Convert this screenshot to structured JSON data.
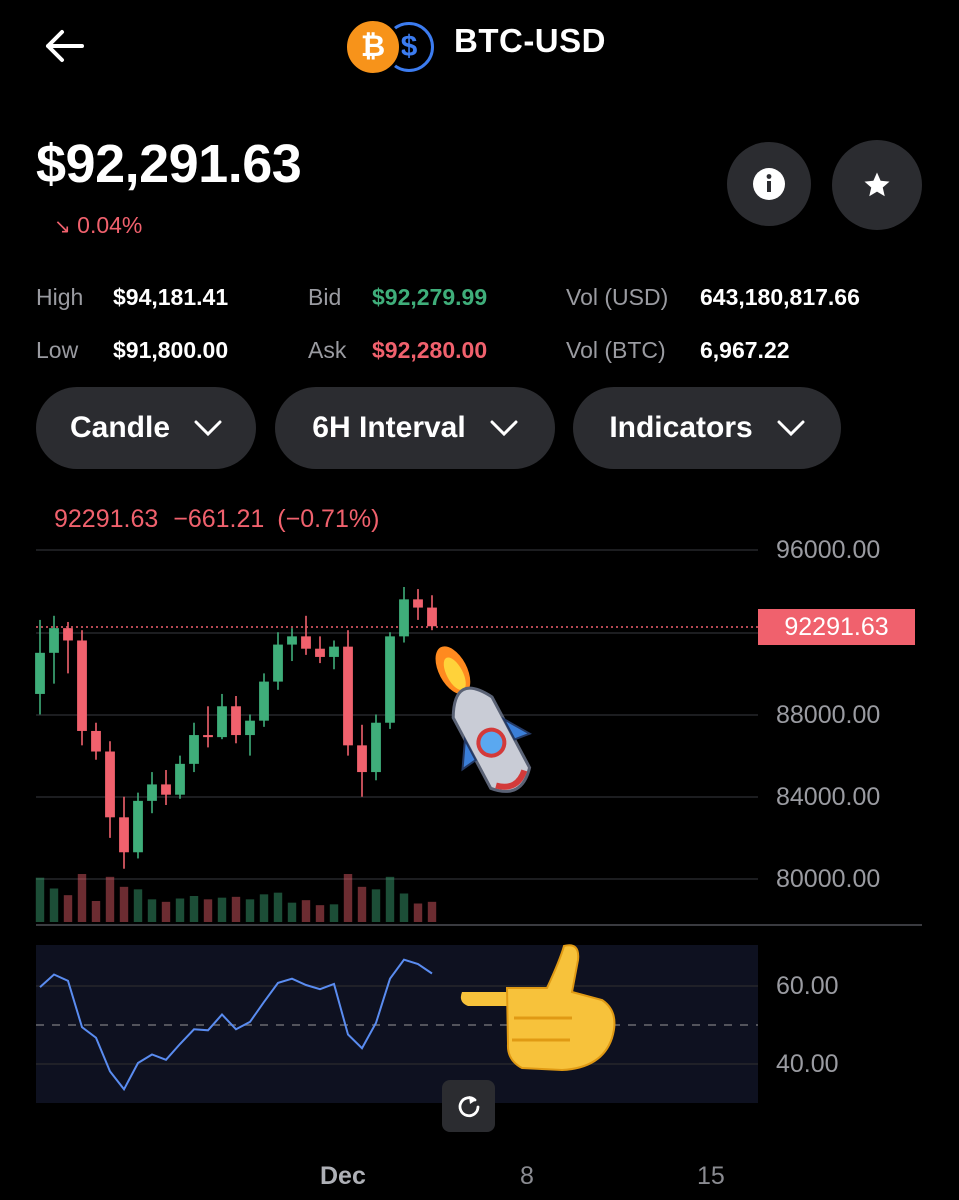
{
  "header": {
    "title": "BTC-USD",
    "btc_symbol": "₿",
    "usd_symbol": "$"
  },
  "price": {
    "current": "$92,291.63",
    "change_pct": "0.04%",
    "change_dir": "down"
  },
  "stats": {
    "high_label": "High",
    "high": "$94,181.41",
    "low_label": "Low",
    "low": "$91,800.00",
    "bid_label": "Bid",
    "bid": "$92,279.99",
    "ask_label": "Ask",
    "ask": "$92,280.00",
    "vol_usd_label": "Vol (USD)",
    "vol_usd": "643,180,817.66",
    "vol_btc_label": "Vol (BTC)",
    "vol_btc": "6,967.22"
  },
  "controls": {
    "chart_type": "Candle",
    "interval": "6H Interval",
    "indicators": "Indicators"
  },
  "chart": {
    "ohlc_close": "92291.63",
    "ohlc_change": "−661.21",
    "ohlc_change_pct": "(−0.71%)",
    "price_tag": "92291.63",
    "y_ticks": [
      "96000.00",
      "88000.00",
      "84000.00",
      "80000.00"
    ],
    "rsi_ticks": [
      "60.00",
      "40.00"
    ],
    "x_ticks": [
      "Dec",
      "8",
      "15"
    ]
  },
  "colors": {
    "up": "#3fae7a",
    "down": "#f0616d",
    "rsi": "#5a8cf0",
    "bg": "#000000",
    "pill": "#2b2c30"
  },
  "icons": [
    "back-arrow-icon",
    "info-icon",
    "star-icon",
    "chevron-down-icon",
    "reset-icon",
    "rocket-emoji",
    "pointing-hand-emoji"
  ],
  "chart_data": {
    "type": "candlestick",
    "interval": "6H",
    "current_price": 92291.63,
    "ylim": [
      78000,
      96000
    ],
    "price_line": 92291.63,
    "candles_approx": [
      {
        "o": 89000,
        "h": 92600,
        "l": 88000,
        "c": 91000
      },
      {
        "o": 91000,
        "h": 92800,
        "l": 89500,
        "c": 92200
      },
      {
        "o": 92200,
        "h": 92500,
        "l": 90000,
        "c": 91600
      },
      {
        "o": 91600,
        "h": 92100,
        "l": 86500,
        "c": 87200
      },
      {
        "o": 87200,
        "h": 87600,
        "l": 85800,
        "c": 86200
      },
      {
        "o": 86200,
        "h": 86700,
        "l": 82000,
        "c": 83000
      },
      {
        "o": 83000,
        "h": 84000,
        "l": 80500,
        "c": 81300
      },
      {
        "o": 81300,
        "h": 84200,
        "l": 81000,
        "c": 83800
      },
      {
        "o": 83800,
        "h": 85200,
        "l": 83200,
        "c": 84600
      },
      {
        "o": 84600,
        "h": 85300,
        "l": 83600,
        "c": 84100
      },
      {
        "o": 84100,
        "h": 86000,
        "l": 83900,
        "c": 85600
      },
      {
        "o": 85600,
        "h": 87600,
        "l": 85200,
        "c": 87000
      },
      {
        "o": 87000,
        "h": 88400,
        "l": 86400,
        "c": 86900
      },
      {
        "o": 86900,
        "h": 89000,
        "l": 86800,
        "c": 88400
      },
      {
        "o": 88400,
        "h": 88900,
        "l": 86600,
        "c": 87000
      },
      {
        "o": 87000,
        "h": 88000,
        "l": 86000,
        "c": 87700
      },
      {
        "o": 87700,
        "h": 90000,
        "l": 87400,
        "c": 89600
      },
      {
        "o": 89600,
        "h": 92000,
        "l": 89200,
        "c": 91400
      },
      {
        "o": 91400,
        "h": 92200,
        "l": 90600,
        "c": 91800
      },
      {
        "o": 91800,
        "h": 92800,
        "l": 90900,
        "c": 91200
      },
      {
        "o": 91200,
        "h": 91800,
        "l": 90500,
        "c": 90800
      },
      {
        "o": 90800,
        "h": 91600,
        "l": 90200,
        "c": 91300
      },
      {
        "o": 91300,
        "h": 92100,
        "l": 86000,
        "c": 86500
      },
      {
        "o": 86500,
        "h": 87500,
        "l": 84000,
        "c": 85200
      },
      {
        "o": 85200,
        "h": 88000,
        "l": 84800,
        "c": 87600
      },
      {
        "o": 87600,
        "h": 92000,
        "l": 87300,
        "c": 91800
      },
      {
        "o": 91800,
        "h": 94200,
        "l": 91500,
        "c": 93600
      },
      {
        "o": 93600,
        "h": 94100,
        "l": 92600,
        "c": 93200
      },
      {
        "o": 93200,
        "h": 93800,
        "l": 92100,
        "c": 92291.63
      }
    ],
    "rsi_ylim": [
      30,
      70
    ],
    "rsi_ticks": [
      60,
      40
    ],
    "x_ticks": [
      "Dec",
      "8",
      "15"
    ]
  }
}
